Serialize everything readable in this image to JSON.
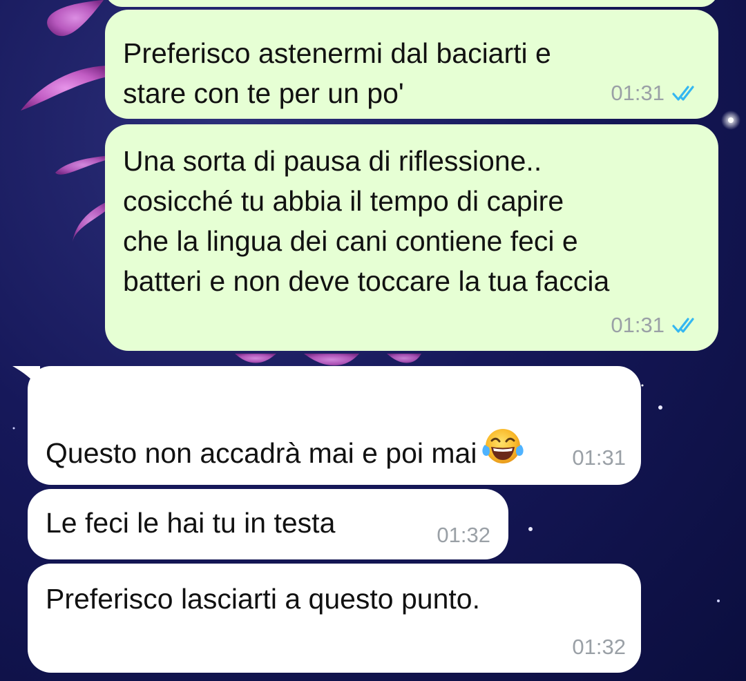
{
  "background": {
    "colors": {
      "deep": "#0b0e3e",
      "mid": "#16185a",
      "petal": "#c95fc8"
    }
  },
  "messages": [
    {
      "direction": "outgoing",
      "text": "Preferisco astenermi dal baciarti e\nstare con te per un po'",
      "time": "01:31",
      "status_icon": "double-check-icon"
    },
    {
      "direction": "outgoing",
      "text": "Una sorta di pausa di riflessione..\ncosicché tu abbia il tempo di capire\nche la lingua dei cani contiene feci e\nbatteri e non deve toccare la tua faccia",
      "time": "01:31",
      "status_icon": "double-check-icon"
    },
    {
      "direction": "incoming",
      "text": "Questo non accadrà mai e poi mai",
      "emoji": "face-with-tears-of-joy",
      "time": "01:31"
    },
    {
      "direction": "incoming",
      "text": "Le feci le hai tu in testa",
      "time": "01:32"
    },
    {
      "direction": "incoming",
      "text": "Preferisco lasciarti a questo punto.",
      "time": "01:32"
    }
  ],
  "colors": {
    "outgoing_bubble": "#e6ffd4",
    "incoming_bubble": "#ffffff",
    "timestamp": "#9aa0a6",
    "read_ticks": "#34b7f1"
  }
}
